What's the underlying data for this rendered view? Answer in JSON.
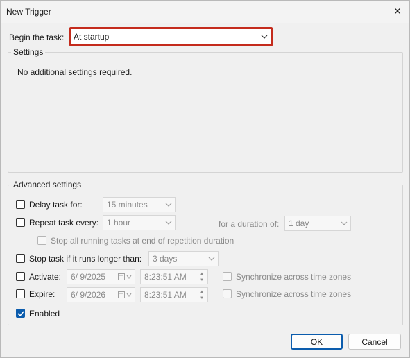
{
  "window": {
    "title": "New Trigger",
    "close_glyph": "✕"
  },
  "begin_task": {
    "label": "Begin the task:",
    "selected": "At startup"
  },
  "settings_group": {
    "legend": "Settings",
    "message": "No additional settings required."
  },
  "advanced_group": {
    "legend": "Advanced settings",
    "delay": {
      "label": "Delay task for:",
      "value": "15 minutes",
      "checked": false
    },
    "repeat": {
      "label": "Repeat task every:",
      "value": "1 hour",
      "checked": false,
      "duration_label": "for a duration of:",
      "duration_value": "1 day"
    },
    "stop_running": {
      "label": "Stop all running tasks at end of repetition duration",
      "checked": false
    },
    "stop_if_longer": {
      "label": "Stop task if it runs longer than:",
      "value": "3 days",
      "checked": false
    },
    "activate": {
      "label": "Activate:",
      "date": "6/  9/2025",
      "time": "8:23:51 AM",
      "checked": false,
      "sync_label": "Synchronize across time zones"
    },
    "expire": {
      "label": "Expire:",
      "date": "6/  9/2026",
      "time": "8:23:51 AM",
      "checked": false,
      "sync_label": "Synchronize across time zones"
    },
    "enabled": {
      "label": "Enabled",
      "checked": true
    }
  },
  "buttons": {
    "ok": "OK",
    "cancel": "Cancel"
  },
  "colors": {
    "accent": "#0b5cad",
    "highlight": "#c42b1c"
  },
  "icons": [
    "close-icon",
    "chevron-down-icon",
    "calendar-icon",
    "spin-up-icon",
    "spin-down-icon",
    "checkmark-icon"
  ]
}
